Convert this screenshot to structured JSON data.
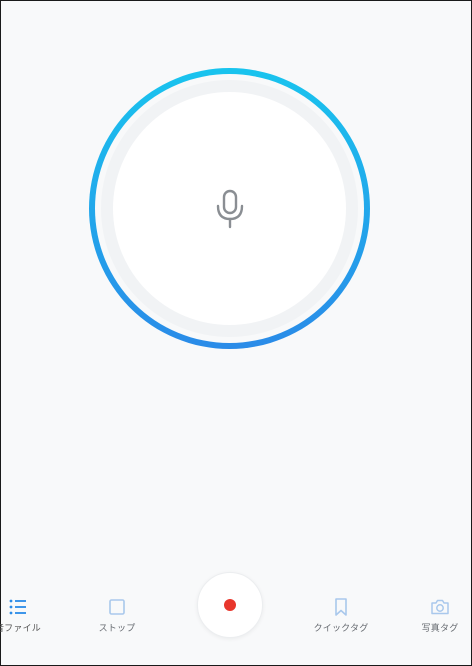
{
  "recorder": {
    "status_icon": "microphone-icon",
    "ring_colors": {
      "top": "#19c4ee",
      "bottom": "#2a8be8"
    }
  },
  "toolbar": {
    "files_label": "音ファイル",
    "stop_label": "ストップ",
    "quick_tag_label": "クイックタグ",
    "photo_tag_label": "写真タグ",
    "record_color": "#e8362c",
    "accent_color": "#2a8be8"
  }
}
